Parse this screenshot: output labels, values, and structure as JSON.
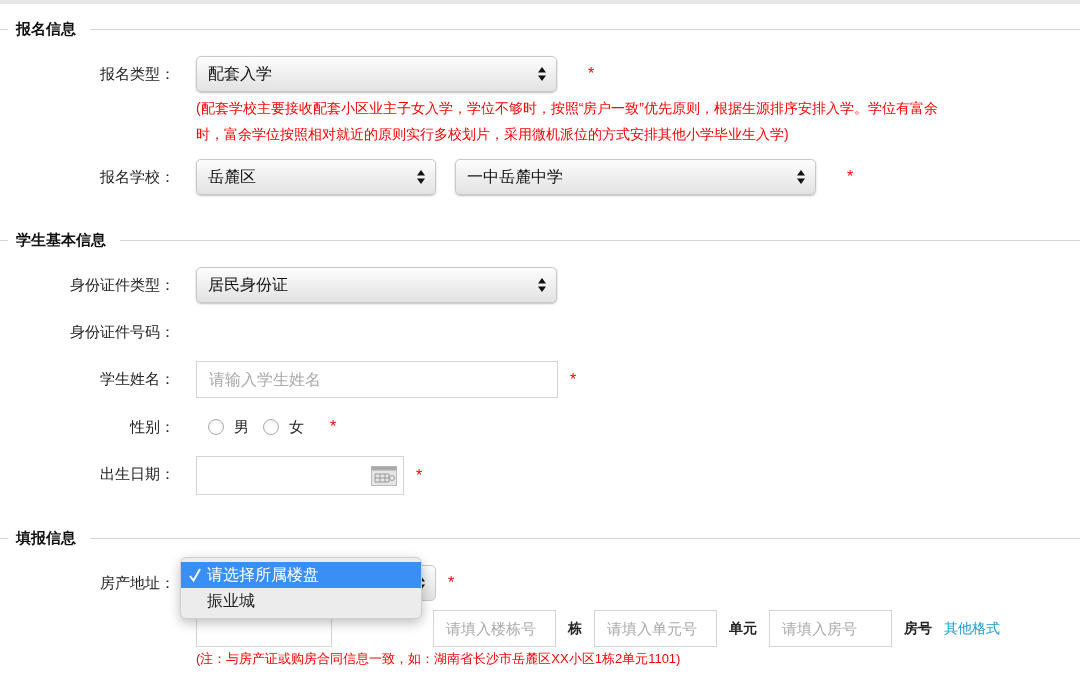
{
  "sections": [
    {
      "title": "报名信息",
      "rows": [
        {
          "kind": "select",
          "label": "报名类型：",
          "required_mark": "*",
          "selects": [
            {
              "value": "配套入学"
            }
          ],
          "note": "(配套学校主要接收配套小区业主子女入学，学位不够时，按照“房户一致”优先原则，根据生源排序安排入学。学位有富余时，富余学位按照相对就近的原则实行多校划片，采用微机派位的方式安排其他小学毕业生入学)"
        },
        {
          "kind": "select",
          "label": "报名学校：",
          "required_mark": "*",
          "selects": [
            {
              "value": "岳麓区"
            },
            {
              "value": "一中岳麓中学"
            }
          ]
        }
      ]
    },
    {
      "title": "学生基本信息",
      "rows": [
        {
          "kind": "select",
          "label": "身份证件类型：",
          "selects": [
            {
              "value": "居民身份证"
            }
          ]
        },
        {
          "kind": "text",
          "label": "身份证件号码："
        },
        {
          "kind": "input",
          "label": "学生姓名：",
          "required_mark": "*",
          "placeholder": "请输入学生姓名"
        },
        {
          "kind": "radio",
          "label": "性别：",
          "required_mark": "*",
          "options": [
            {
              "label": "男",
              "selected": false
            },
            {
              "label": "女",
              "selected": false
            }
          ]
        },
        {
          "kind": "date",
          "label": "出生日期：",
          "required_mark": "*"
        }
      ]
    },
    {
      "title": "填报信息",
      "rows": [
        {
          "kind": "address",
          "label": "房产地址：",
          "required_mark": "*",
          "menu": [
            {
              "label": "请选择所属楼盘",
              "selected": true
            },
            {
              "label": "振业城",
              "selected": false
            }
          ],
          "fields": [
            {
              "placeholder": "请填入楼栋号",
              "unit": "栋"
            },
            {
              "placeholder": "请填入单元号",
              "unit": "单元"
            },
            {
              "placeholder": "请填入房号",
              "unit": "房号"
            }
          ],
          "link": "其他格式",
          "note": "(注：与房产证或购房合同信息一致，如：湖南省长沙市岳麓区XX小区1栋2单元1101)"
        }
      ]
    }
  ]
}
